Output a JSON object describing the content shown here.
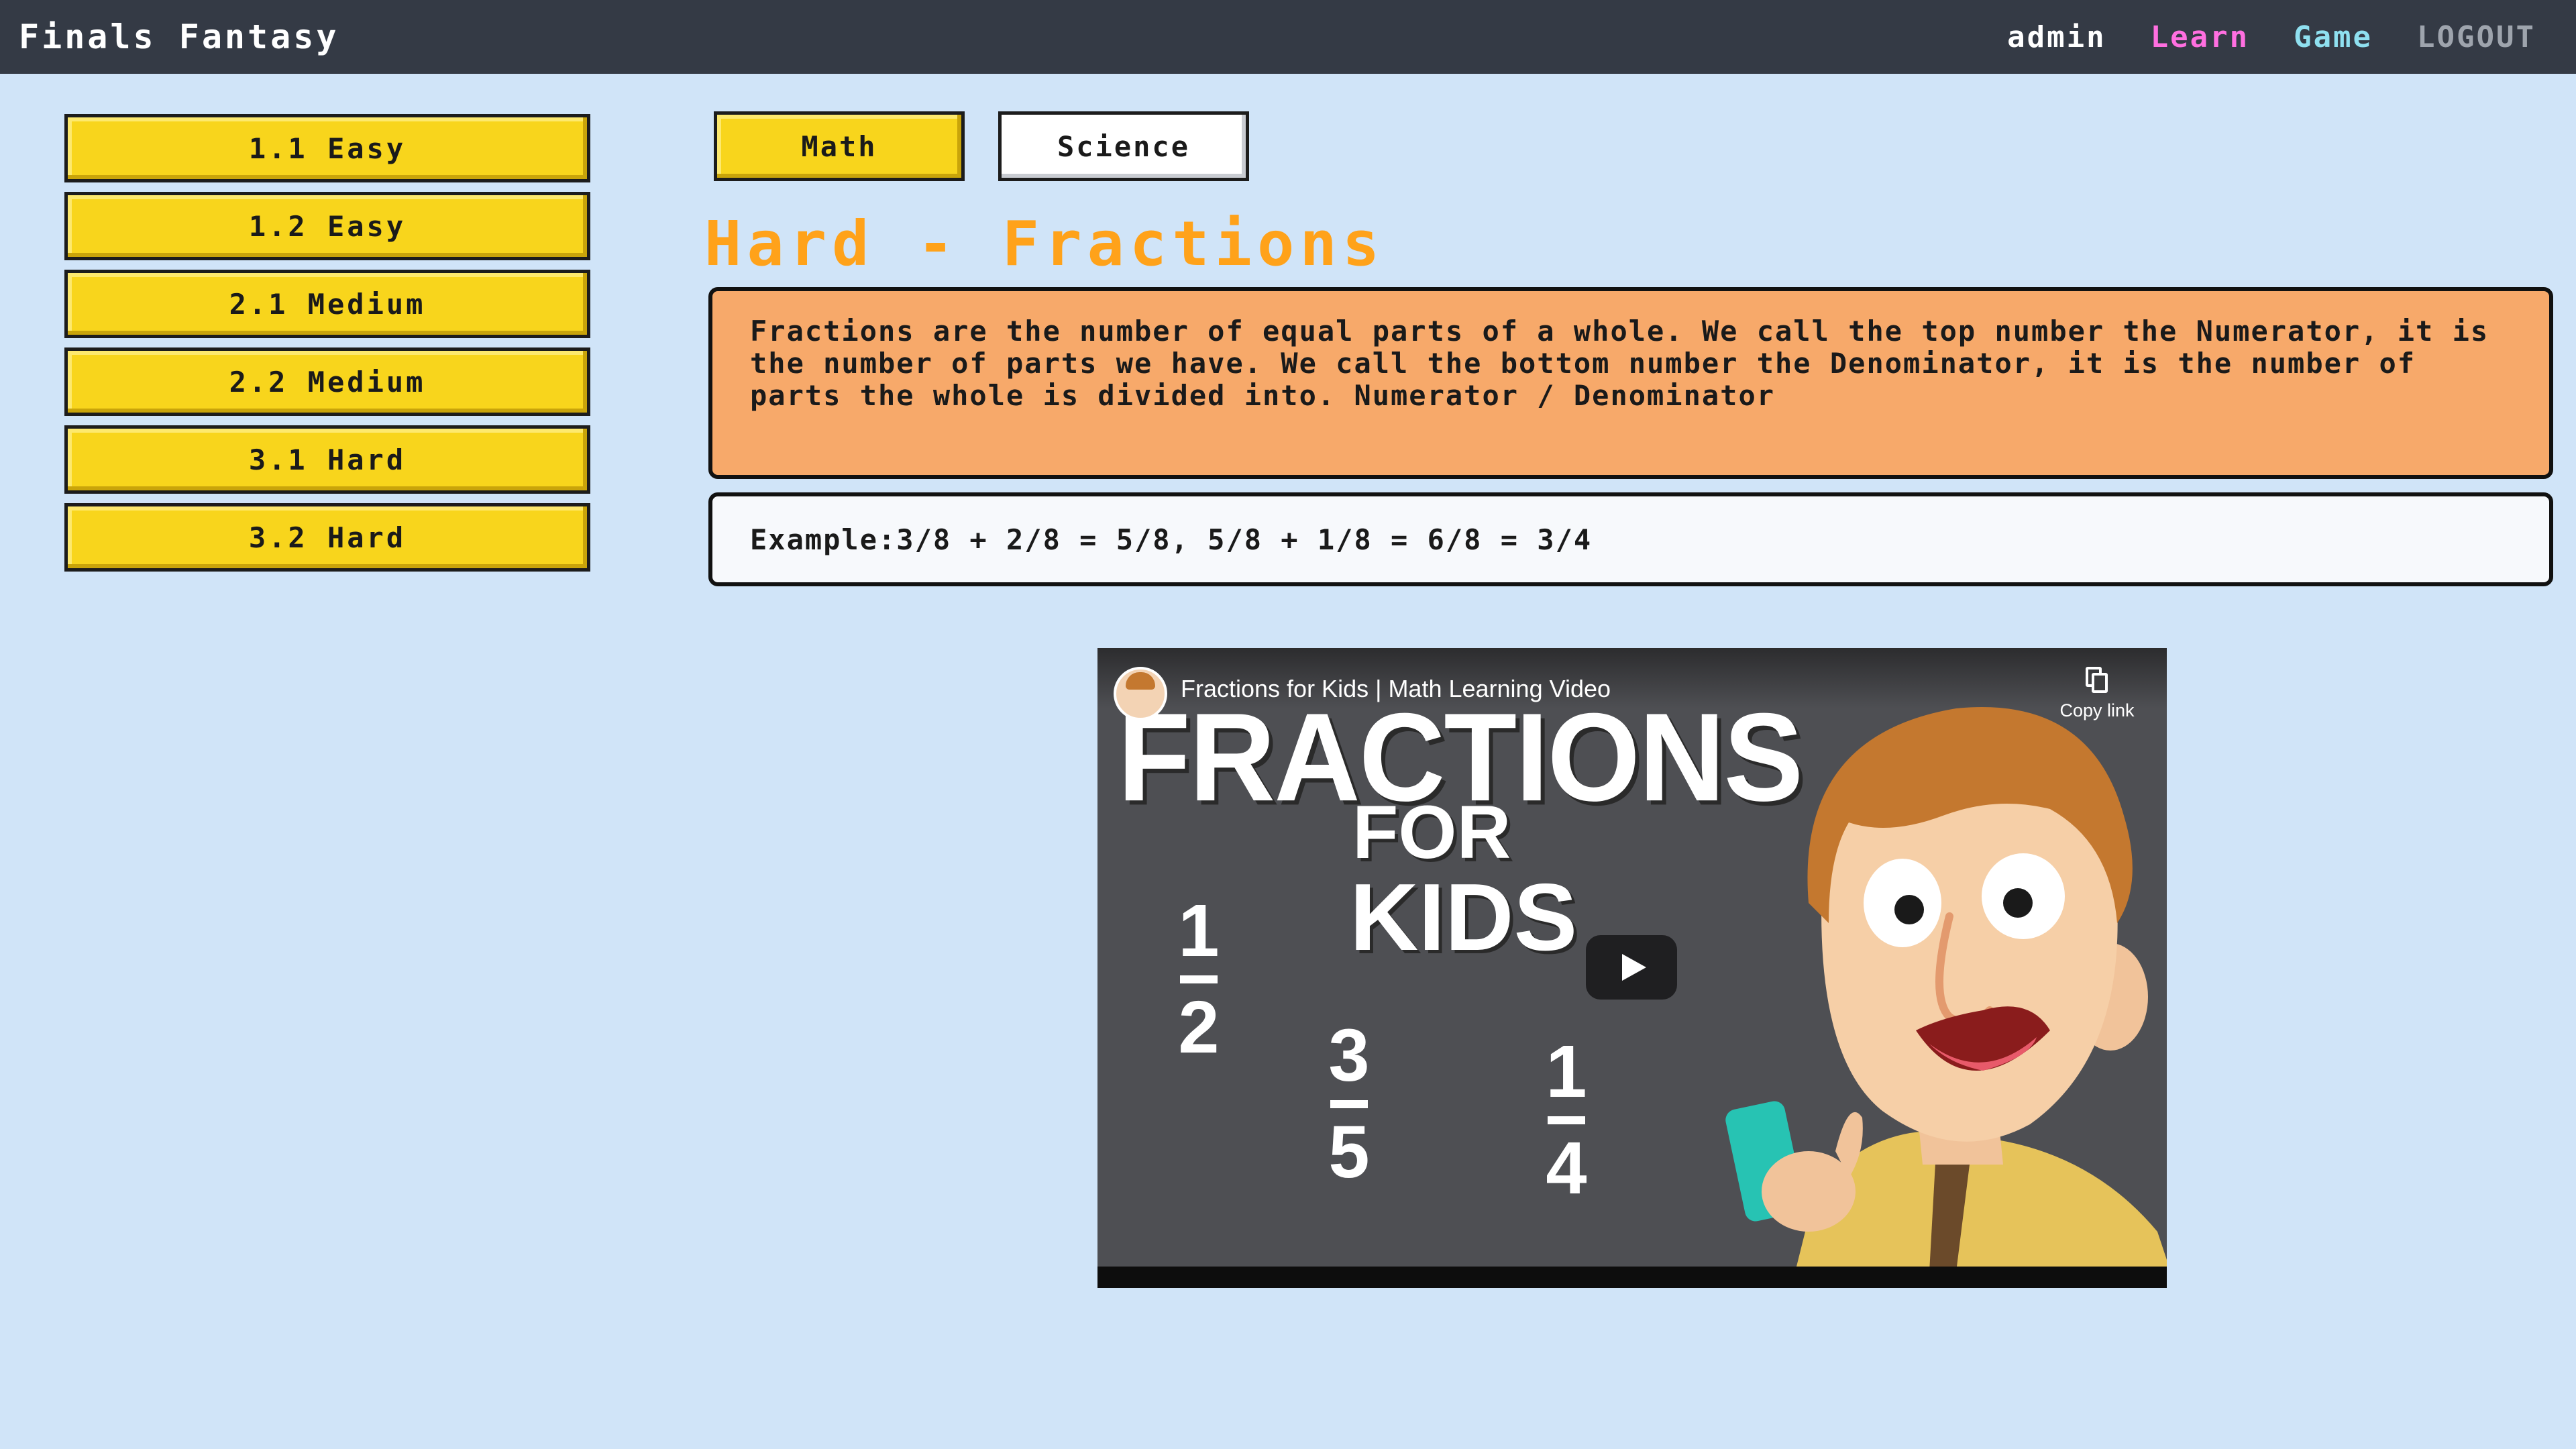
{
  "app": {
    "title": "Finals Fantasy"
  },
  "nav": {
    "user": "admin",
    "learn": "Learn",
    "game": "Game",
    "logout": "LOGOUT"
  },
  "levels": [
    "1.1 Easy",
    "1.2 Easy",
    "2.1 Medium",
    "2.2 Medium",
    "3.1 Hard",
    "3.2 Hard"
  ],
  "tabs": {
    "math": "Math",
    "science": "Science"
  },
  "lesson": {
    "title": "Hard - Fractions",
    "description": "Fractions are the number of equal parts of a whole. We call the top number the Numerator, it is the number of parts we have. We call the bottom number the Denominator, it is the number of parts the whole is divided into. Numerator / Denominator",
    "example": "Example:3/8 + 2/8 = 5/8, 5/8 + 1/8 = 6/8 = 3/4"
  },
  "video": {
    "title": "Fractions for Kids | Math Learning Video",
    "copy_link": "Copy link",
    "thumb_headline": "FRACTIONS",
    "thumb_for": "FOR",
    "thumb_kids": "KIDS",
    "fractions": [
      {
        "num": "1",
        "den": "2"
      },
      {
        "num": "3",
        "den": "5"
      },
      {
        "num": "1",
        "den": "4"
      }
    ]
  },
  "colors": {
    "topbar": "#343a45",
    "background": "#d0e4f8",
    "button_yellow": "#f8d51c",
    "title_orange": "#ffa21a",
    "desc_box": "#f7a96a",
    "nav_learn": "#ff6fe0",
    "nav_game": "#8fe0f0"
  },
  "icons": {
    "copy": "copy-icon",
    "play": "play-icon"
  }
}
